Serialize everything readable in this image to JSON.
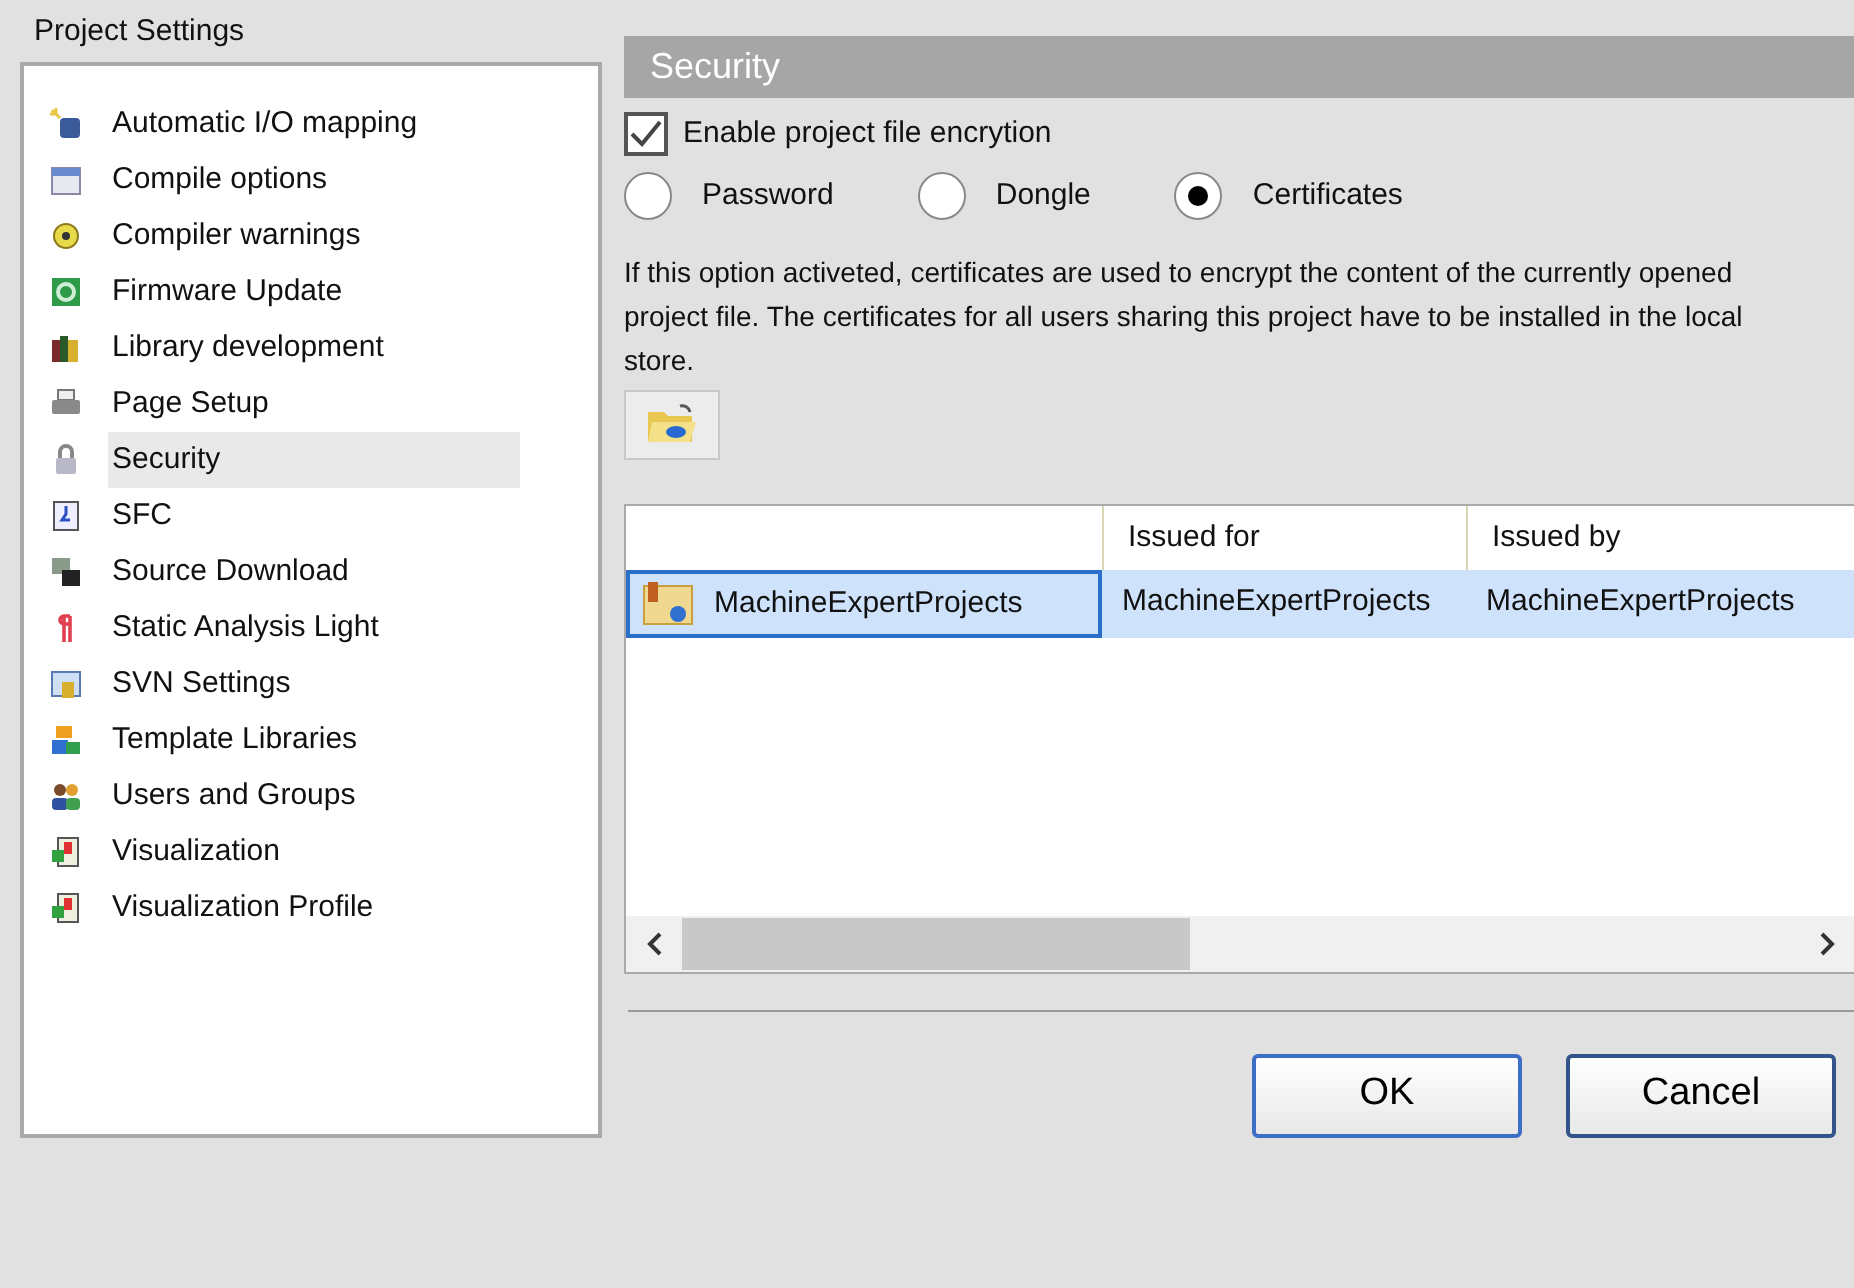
{
  "window": {
    "title": "Project Settings"
  },
  "sidebar": {
    "items": [
      {
        "label": "Automatic I/O mapping",
        "selected": false
      },
      {
        "label": "Compile options",
        "selected": false
      },
      {
        "label": "Compiler warnings",
        "selected": false
      },
      {
        "label": "Firmware Update",
        "selected": false
      },
      {
        "label": "Library development",
        "selected": false
      },
      {
        "label": "Page Setup",
        "selected": false
      },
      {
        "label": "Security",
        "selected": true
      },
      {
        "label": "SFC",
        "selected": false
      },
      {
        "label": "Source Download",
        "selected": false
      },
      {
        "label": "Static Analysis Light",
        "selected": false
      },
      {
        "label": "SVN Settings",
        "selected": false
      },
      {
        "label": "Template Libraries",
        "selected": false
      },
      {
        "label": "Users and Groups",
        "selected": false
      },
      {
        "label": "Visualization",
        "selected": false
      },
      {
        "label": "Visualization Profile",
        "selected": false
      }
    ]
  },
  "panel": {
    "title": "Security",
    "encryption": {
      "label": "Enable project file encrytion",
      "checked": true
    },
    "methods": [
      {
        "label": "Password",
        "selected": false
      },
      {
        "label": "Dongle",
        "selected": false
      },
      {
        "label": "Certificates",
        "selected": true
      }
    ],
    "description": "If this option activeted, certificates are used to encrypt the content of the currently opened project file. The certificates for all users sharing this project have to be installed in the local store.",
    "table": {
      "columns": [
        "",
        "Issued for",
        "Issued by"
      ],
      "rows": [
        {
          "selected": true,
          "cells": [
            "MachineExpertProjects",
            "MachineExpertProjects",
            "MachineExpertProjects"
          ]
        }
      ]
    }
  },
  "buttons": [
    {
      "label": "OK",
      "default": true
    },
    {
      "label": "Cancel",
      "default": false
    }
  ]
}
